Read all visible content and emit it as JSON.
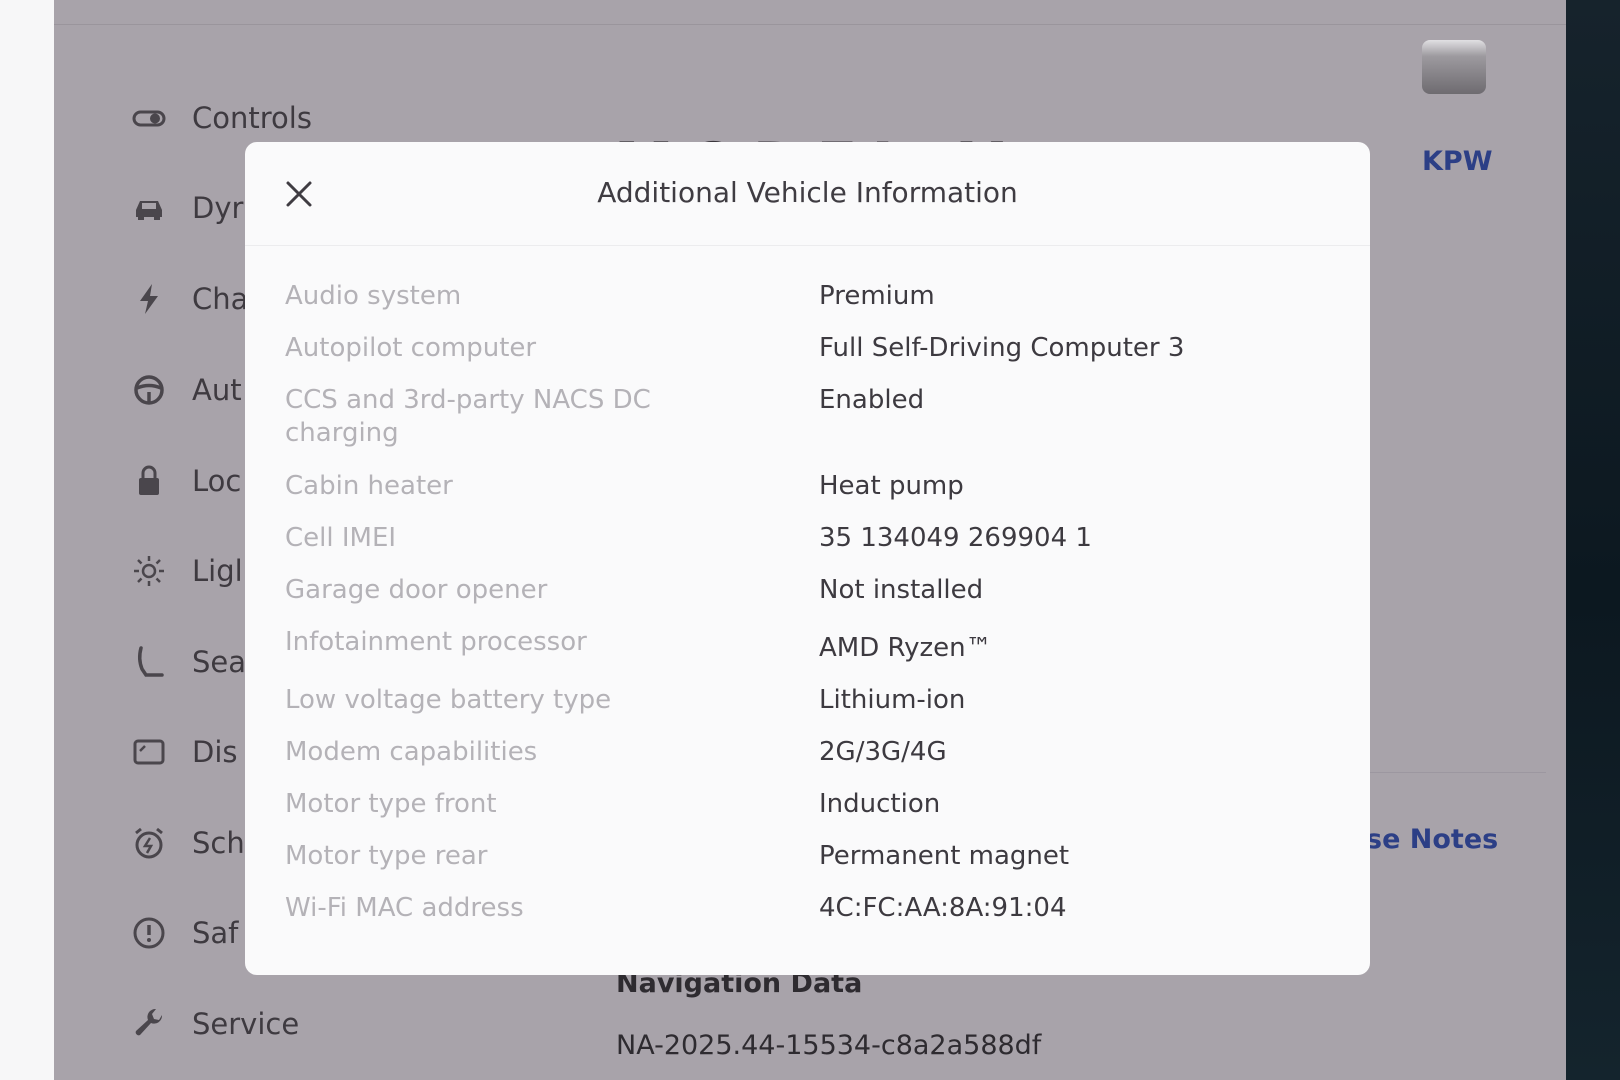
{
  "sidebar": {
    "items": [
      {
        "label": "Controls",
        "icon": "toggle-icon"
      },
      {
        "label": "Dyr",
        "icon": "car-icon"
      },
      {
        "label": "Cha",
        "icon": "lightning-icon"
      },
      {
        "label": "Aut",
        "icon": "steering-wheel-icon"
      },
      {
        "label": "Loc",
        "icon": "lock-icon"
      },
      {
        "label": "Ligl",
        "icon": "sun-icon"
      },
      {
        "label": "Sea",
        "icon": "seat-icon"
      },
      {
        "label": "Dis",
        "icon": "display-icon"
      },
      {
        "label": "Sch",
        "icon": "alarm-clock-icon"
      },
      {
        "label": "Saf",
        "icon": "alert-circle-icon"
      },
      {
        "label": "Service",
        "icon": "wrench-icon"
      }
    ]
  },
  "background": {
    "model_name": "MODEL X",
    "nickname": "KPW",
    "release_notes_link": "se Notes",
    "navigation_data_heading": "Navigation Data",
    "navigation_data_value": "NA-2025.44-15534-c8a2a588df"
  },
  "modal": {
    "title": "Additional Vehicle Information",
    "rows": [
      {
        "label": "Audio system",
        "value": "Premium"
      },
      {
        "label": "Autopilot computer",
        "value": "Full Self-Driving Computer 3"
      },
      {
        "label": "CCS and 3rd-party NACS DC charging",
        "value": "Enabled"
      },
      {
        "label": "Cabin heater",
        "value": "Heat pump"
      },
      {
        "label": "Cell IMEI",
        "value": "35 134049 269904 1"
      },
      {
        "label": "Garage door opener",
        "value": "Not installed"
      },
      {
        "label": "Infotainment processor",
        "value": "AMD Ryzen™"
      },
      {
        "label": "Low voltage battery type",
        "value": "Lithium-ion"
      },
      {
        "label": "Modem capabilities",
        "value": "2G/3G/4G"
      },
      {
        "label": "Motor type front",
        "value": "Induction"
      },
      {
        "label": "Motor type rear",
        "value": "Permanent magnet"
      },
      {
        "label": "Wi-Fi MAC address",
        "value": "4C:FC:AA:8A:91:04"
      }
    ]
  },
  "colors": {
    "accent_link": "#2c3f86",
    "overlay_dim": "#a8a3aa",
    "modal_bg": "#fafafb"
  }
}
